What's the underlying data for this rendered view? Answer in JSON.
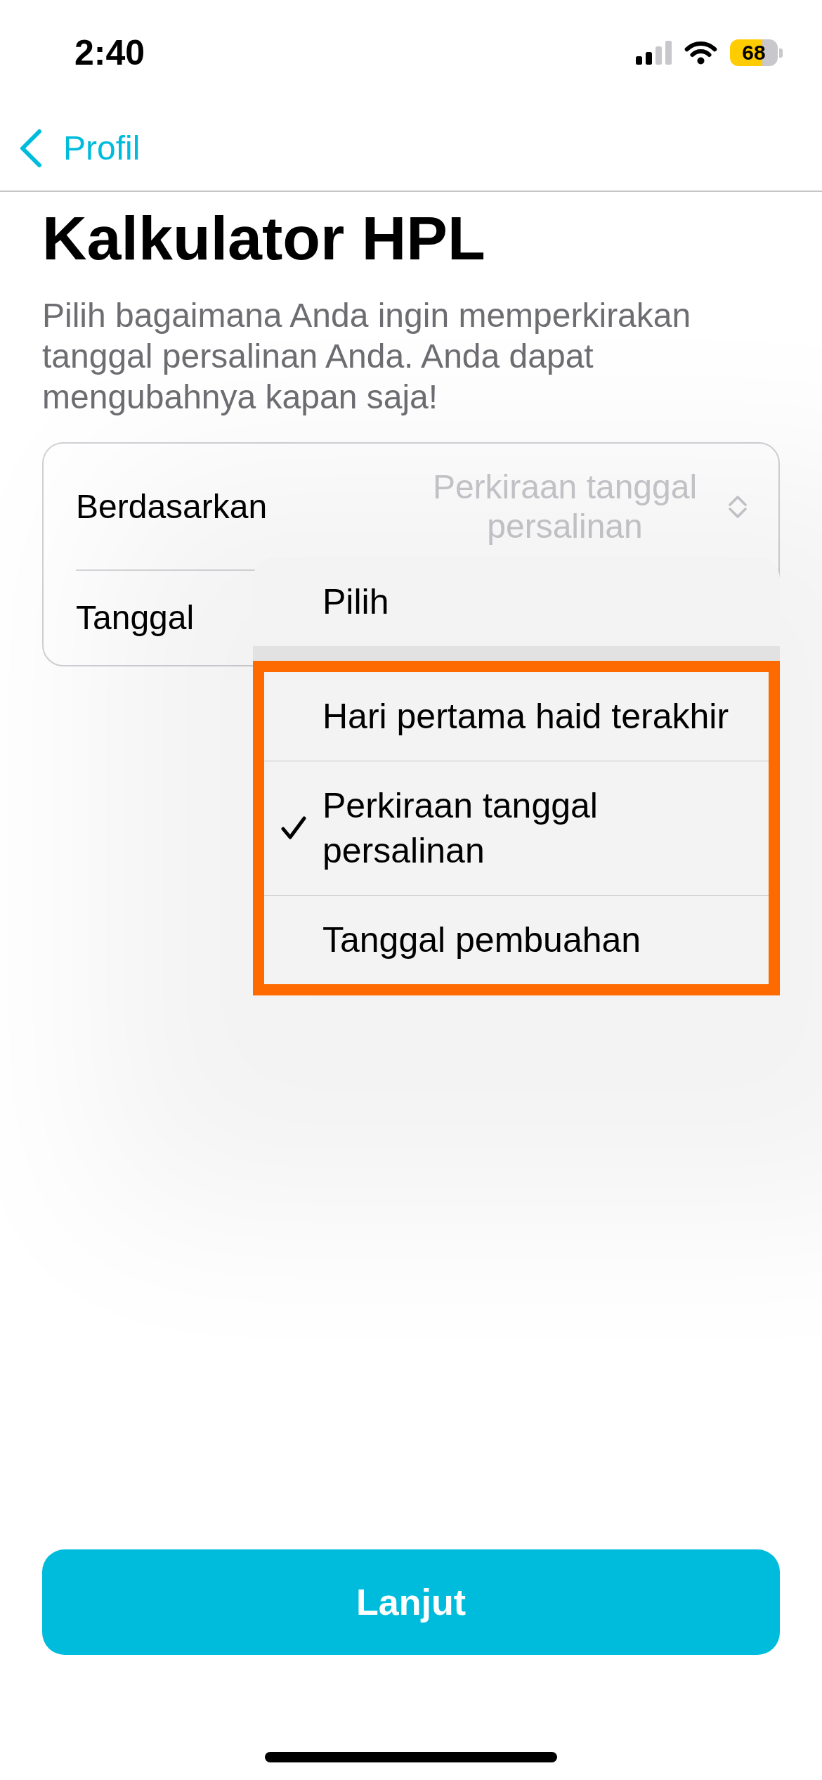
{
  "status_bar": {
    "time": "2:40",
    "battery": "68"
  },
  "nav": {
    "back_label": "Profil"
  },
  "title": "Kalkulator HPL",
  "description": "Pilih bagaimana Anda ingin memperkirakan tanggal persalinan Anda. Anda dapat mengubahnya kapan saja!",
  "form": {
    "rows": [
      {
        "kind": "select",
        "label": "Berdasarkan",
        "value": "Perkiraan tanggal persalinan"
      },
      {
        "kind": "date",
        "label": "Tanggal"
      }
    ]
  },
  "menu": {
    "sections": [
      {
        "highlighted": false,
        "options": [
          {
            "label": "Pilih",
            "selected": false
          }
        ]
      },
      {
        "highlighted": true,
        "options": [
          {
            "label": "Hari pertama haid terakhir",
            "selected": false
          },
          {
            "label": "Perkiraan tanggal persalinan",
            "selected": true
          },
          {
            "label": "Tanggal pembuahan",
            "selected": false
          }
        ]
      }
    ]
  },
  "primary_button": {
    "label": "Lanjut"
  }
}
